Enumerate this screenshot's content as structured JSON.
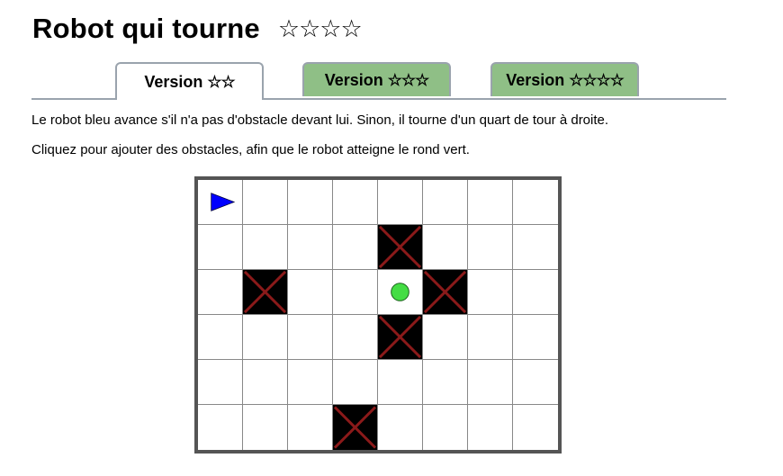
{
  "header": {
    "title": "Robot qui tourne",
    "difficulty_stars": "☆☆☆☆"
  },
  "tabs": [
    {
      "label": "Version",
      "stars": "☆☆",
      "active": true
    },
    {
      "label": "Version",
      "stars": "☆☆☆",
      "active": false
    },
    {
      "label": "Version",
      "stars": "☆☆☆☆",
      "active": false
    }
  ],
  "instructions": {
    "line1": "Le robot bleu avance s'il n'a pas d'obstacle devant lui. Sinon, il tourne d'un quart de tour à droite.",
    "line2": "Cliquez pour ajouter des obstacles, afin que le robot atteigne le rond vert."
  },
  "board": {
    "rows": 6,
    "cols": 8,
    "robot": {
      "row": 0,
      "col": 0,
      "direction": "right",
      "color": "#0000ff",
      "icon": "robot-triangle-icon"
    },
    "target": {
      "row": 2,
      "col": 4,
      "color": "#44dd44",
      "icon": "green-circle-icon"
    },
    "obstacles": [
      {
        "row": 1,
        "col": 4
      },
      {
        "row": 2,
        "col": 1
      },
      {
        "row": 2,
        "col": 5
      },
      {
        "row": 3,
        "col": 4
      },
      {
        "row": 5,
        "col": 3
      }
    ],
    "obstacle_fill": "#000000",
    "obstacle_cross_color": "#8b1a1a",
    "grid_line_color": "#888888",
    "border_color": "#555555"
  },
  "colors": {
    "tab_inactive": "#8fbf86",
    "tab_border": "#9aa3ad"
  }
}
